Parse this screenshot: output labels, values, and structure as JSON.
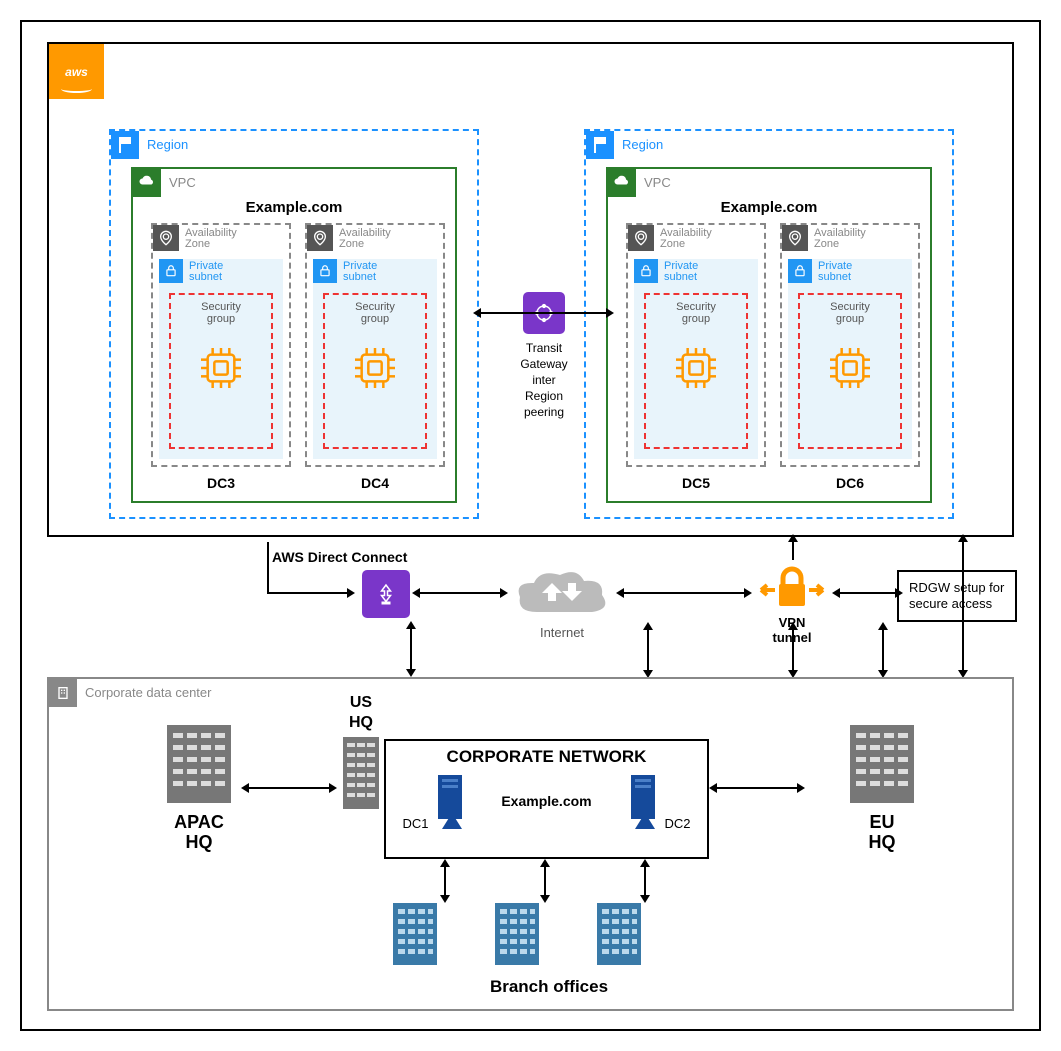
{
  "aws_logo": "aws",
  "regions": [
    {
      "label": "Region",
      "vpc_label": "VPC",
      "domain": "Example.com",
      "az_label": "Availability Zone",
      "subnet_label": "Private subnet",
      "sg_label": "Security group",
      "dcs": [
        "DC3",
        "DC4"
      ]
    },
    {
      "label": "Region",
      "vpc_label": "VPC",
      "domain": "Example.com",
      "az_label": "Availability Zone",
      "subnet_label": "Private subnet",
      "sg_label": "Security group",
      "dcs": [
        "DC5",
        "DC6"
      ]
    }
  ],
  "tgw_label": "Transit Gateway inter Region peering",
  "direct_connect_label": "AWS Direct Connect",
  "internet_label": "Internet",
  "vpn_label": "VPN tunnel",
  "rdgw_label": "RDGW setup for secure access",
  "corp": {
    "label": "Corporate data center",
    "apac": "APAC HQ",
    "us": "US HQ",
    "eu": "EU HQ",
    "network_title": "CORPORATE NETWORK",
    "network_domain": "Example.com",
    "servers": [
      "DC1",
      "DC2"
    ],
    "branch_label": "Branch offices"
  }
}
